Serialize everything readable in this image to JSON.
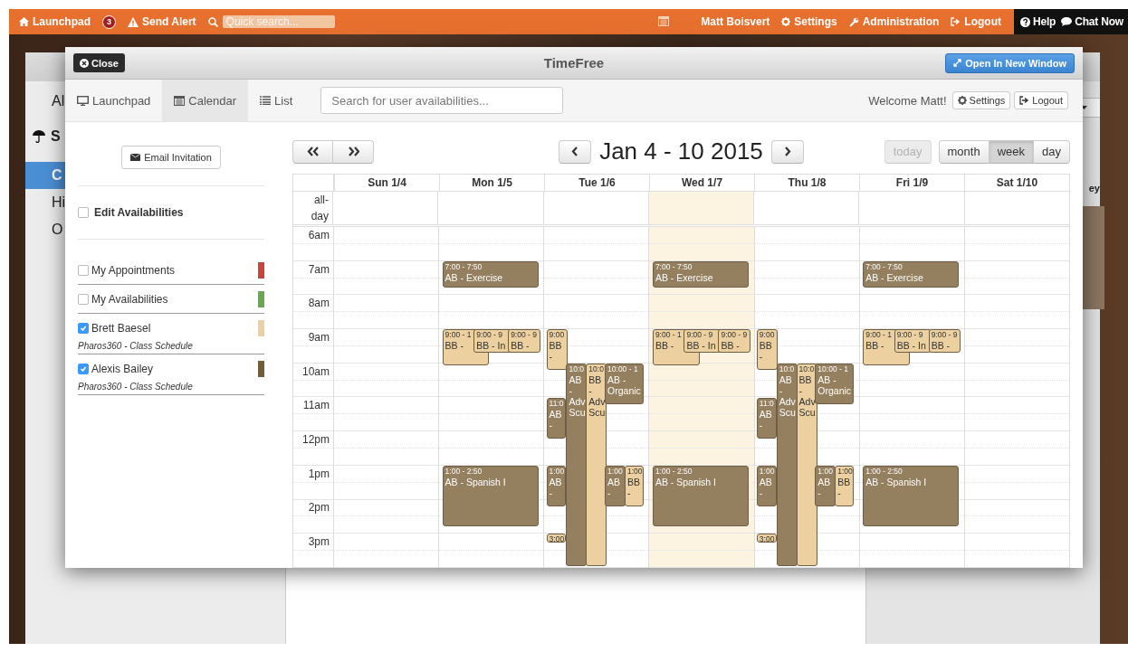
{
  "top_bar": {
    "launchpad": "Launchpad",
    "launchpad_badge": "3",
    "send_alert": "Send Alert",
    "search": {
      "placeholder": "Quick search..."
    },
    "user": "Matt Boisvert",
    "settings": "Settings",
    "administration": "Administration",
    "logout": "Logout",
    "help": "Help",
    "chat": "Chat Now"
  },
  "background": {
    "nav_items": [
      {
        "label": "Al",
        "kind": "link",
        "selected": false
      },
      {
        "label": "S",
        "kind": "heading",
        "selected": false
      },
      {
        "label": "C",
        "kind": "link",
        "selected": true
      },
      {
        "label": "Hi",
        "kind": "link",
        "selected": false
      },
      {
        "label": "O",
        "kind": "link",
        "selected": false
      }
    ],
    "side_text": "ey"
  },
  "modal": {
    "close": "Close",
    "title": "TimeFree",
    "open_new_window": "Open In New Window",
    "tabs": [
      {
        "label": "Launchpad",
        "selected": false
      },
      {
        "label": "Calendar",
        "selected": true
      },
      {
        "label": "List",
        "selected": false
      }
    ],
    "search": {
      "placeholder": "Search for user availabilities..."
    },
    "welcome": "Welcome Matt!",
    "settings": "Settings",
    "logout": "Logout"
  },
  "sidebar": {
    "email_invitation": "Email Invitation",
    "edit_availabilities": {
      "label": "Edit Availabilities",
      "checked": false
    },
    "calendars": [
      {
        "name": "My Appointments",
        "checked": false,
        "color": "#c9443a"
      },
      {
        "name": "My Availabilities",
        "checked": false,
        "color": "#6aa84f"
      },
      {
        "name": "Brett Baesel",
        "checked": true,
        "color": "#ecd09f",
        "source": "Pharos360 - Class Schedule"
      },
      {
        "name": "Alexis Bailey",
        "checked": true,
        "color": "#735d36",
        "source": "Pharos360 - Class Schedule"
      }
    ]
  },
  "calendar": {
    "title": "Jan 4 - 10 2015",
    "today": {
      "label": "today",
      "disabled": true
    },
    "views": [
      {
        "label": "month",
        "selected": false
      },
      {
        "label": "week",
        "selected": true
      },
      {
        "label": "day",
        "selected": false
      }
    ],
    "all_day_label": "all-day",
    "times": [
      "6am",
      "7am",
      "8am",
      "9am",
      "10am",
      "11am",
      "12pm",
      "1pm",
      "2pm",
      "3pm"
    ],
    "days": [
      {
        "label": "Sun 1/4",
        "today": false
      },
      {
        "label": "Mon 1/5",
        "today": false,
        "events": [
          {
            "time": "7:00 - 7:50",
            "title": "AB - Exercise",
            "color": "#947f5f"
          },
          {
            "time": "9:00 - 1",
            "title": "BB -",
            "color": "#ecd09f"
          },
          {
            "time": "9:00 - 9",
            "title": "BB - In",
            "color": "#ecd09f"
          },
          {
            "time": "9:00 - 9",
            "title": "BB -",
            "color": "#ecd09f"
          },
          {
            "time": "1:00 - 2:50",
            "title": "AB - Spanish I",
            "color": "#947f5f"
          }
        ]
      },
      {
        "label": "Tue 1/6",
        "today": false,
        "events": [
          {
            "time": "9:00",
            "title": "BB -",
            "color": "#ecd09f"
          },
          {
            "time": "10:0",
            "title": "AB - Adv Scu",
            "color": "#947f5f"
          },
          {
            "time": "10:0",
            "title": "BB - Adv Scu",
            "color": "#ecd09f"
          },
          {
            "time": "10:00 - 1",
            "title": "AB - Organic",
            "color": "#947f5f"
          },
          {
            "time": "11:0",
            "title": "AB -",
            "color": "#947f5f"
          },
          {
            "time": "1:00",
            "title": "AB -",
            "color": "#947f5f"
          },
          {
            "time": "1:00",
            "title": "AB -",
            "color": "#947f5f"
          },
          {
            "time": "1:00",
            "title": "BB -",
            "color": "#ecd09f"
          },
          {
            "time": "3:00",
            "color": "#ecd09f"
          }
        ]
      },
      {
        "label": "Wed 1/7",
        "today": true,
        "events": [
          {
            "time": "7:00 - 7:50",
            "title": "AB - Exercise",
            "color": "#947f5f"
          },
          {
            "time": "9:00 - 1",
            "title": "BB -",
            "color": "#ecd09f"
          },
          {
            "time": "9:00 - 9",
            "title": "BB - In",
            "color": "#ecd09f"
          },
          {
            "time": "9:00 - 9",
            "title": "BB -",
            "color": "#ecd09f"
          },
          {
            "time": "1:00 - 2:50",
            "title": "AB - Spanish I",
            "color": "#947f5f"
          }
        ]
      },
      {
        "label": "Thu 1/8",
        "today": false,
        "events": [
          {
            "time": "9:00",
            "title": "BB -",
            "color": "#ecd09f"
          },
          {
            "time": "10:0",
            "title": "AB - Adv Scu",
            "color": "#947f5f"
          },
          {
            "time": "10:0",
            "title": "BB - Adv Scu",
            "color": "#ecd09f"
          },
          {
            "time": "10:00 - 1",
            "title": "AB - Organic",
            "color": "#947f5f"
          },
          {
            "time": "11:0",
            "title": "AB -",
            "color": "#947f5f"
          },
          {
            "time": "1:00",
            "title": "AB -",
            "color": "#947f5f"
          },
          {
            "time": "1:00",
            "title": "AB -",
            "color": "#947f5f"
          },
          {
            "time": "1:00",
            "title": "BB -",
            "color": "#ecd09f"
          },
          {
            "time": "3:00",
            "color": "#ecd09f"
          }
        ]
      },
      {
        "label": "Fri 1/9",
        "today": false,
        "events": [
          {
            "time": "7:00 - 7:50",
            "title": "AB - Exercise",
            "color": "#947f5f"
          },
          {
            "time": "9:00 - 1",
            "title": "BB -",
            "color": "#ecd09f"
          },
          {
            "time": "9:00 - 9",
            "title": "BB - In",
            "color": "#ecd09f"
          },
          {
            "time": "9:00 - 9",
            "title": "BB -",
            "color": "#ecd09f"
          },
          {
            "time": "1:00 - 2:50",
            "title": "AB - Spanish I",
            "color": "#947f5f"
          }
        ]
      },
      {
        "label": "Sat 1/10",
        "today": false
      }
    ]
  }
}
